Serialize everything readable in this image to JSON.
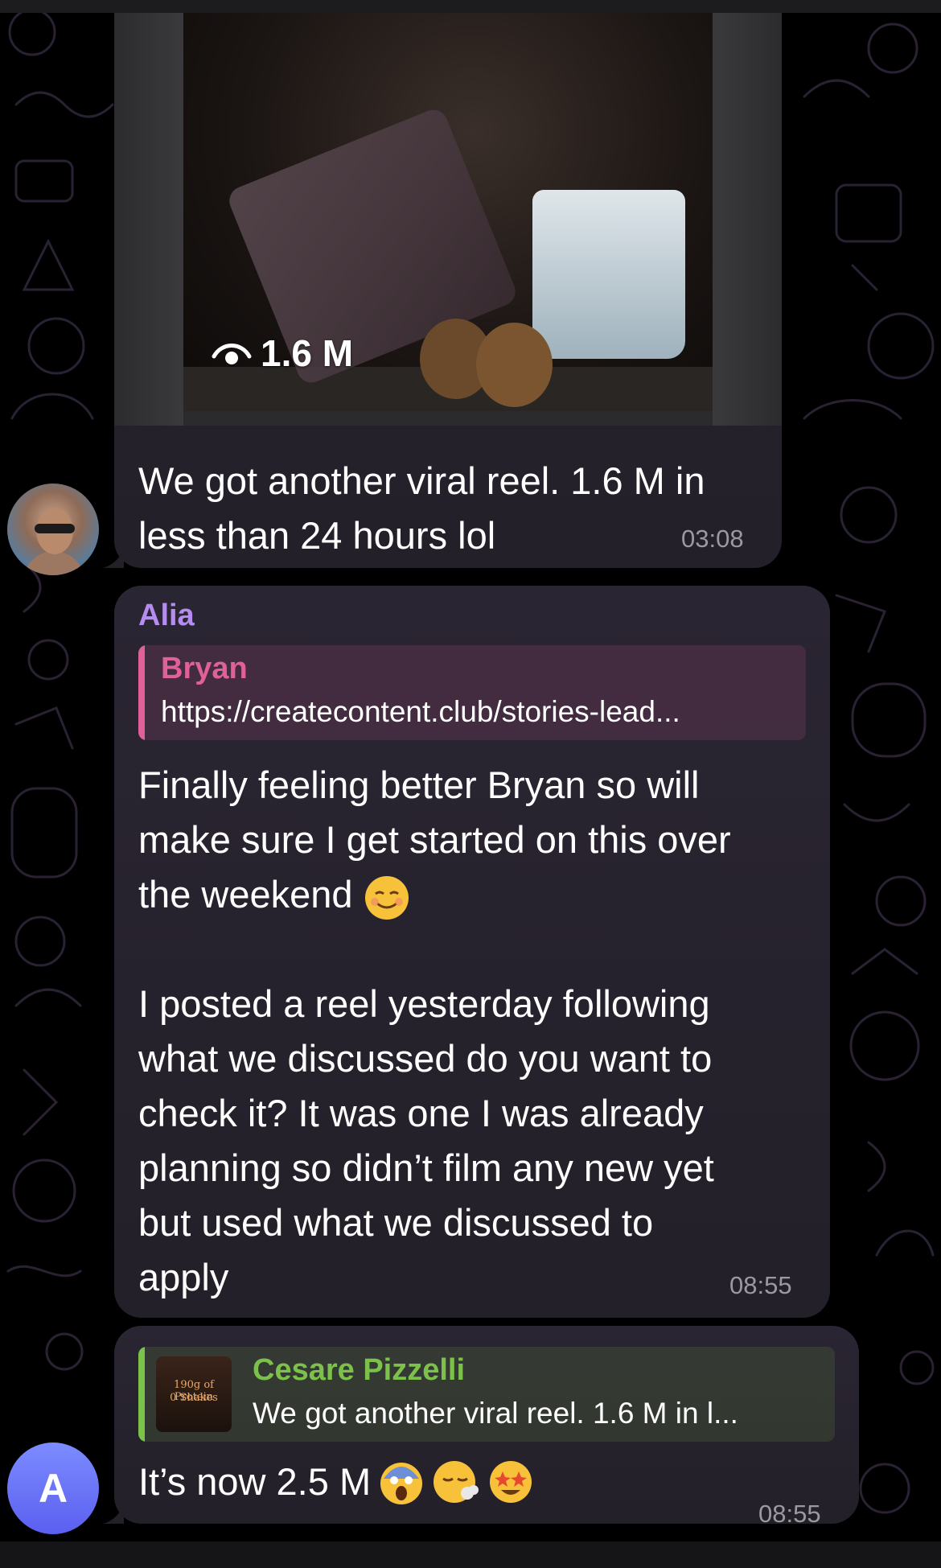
{
  "colors": {
    "background": "#000000",
    "bubble": "#28232f",
    "sender_alia": "#b58df0",
    "reply_bryan": "#e0609a",
    "reply_cesare": "#7cc24a",
    "timestamp": "#9b98a1",
    "avatar_a": "#6a72f7"
  },
  "messages": [
    {
      "id": "msg1",
      "video": {
        "views": "1.6 M",
        "icon": "eye-icon"
      },
      "text": "We got another viral reel. 1.6 M in\nless than 24 hours lol",
      "time": "03:08",
      "avatar": "profile-photo"
    },
    {
      "id": "msg2",
      "sender": "Alia",
      "reply": {
        "name": "Bryan",
        "snippet": "https://createcontent.club/stories-lead..."
      },
      "paragraph1_lines": [
        "Finally feeling better Bryan so will",
        "make sure I get started on this over",
        "the weekend"
      ],
      "paragraph1_emoji": "smiling-face-icon",
      "paragraph2_lines": [
        "I posted a reel yesterday following",
        "what we discussed do you want to",
        "check it? It was one I was already",
        "planning so didn’t film any new yet",
        "but used what we discussed to",
        "apply"
      ],
      "time": "08:55"
    },
    {
      "id": "msg3",
      "reply": {
        "name": "Cesare Pizzelli",
        "snippet": "We got another viral reel. 1.6 M in l...",
        "thumb_lines": [
          "190g of Protein",
          "0 Shakes"
        ]
      },
      "text": "It’s now 2.5 M",
      "emojis": [
        "scream-face-icon",
        "exhaling-face-icon",
        "star-struck-face-icon"
      ],
      "time": "08:55",
      "avatar_letter": "A"
    }
  ]
}
